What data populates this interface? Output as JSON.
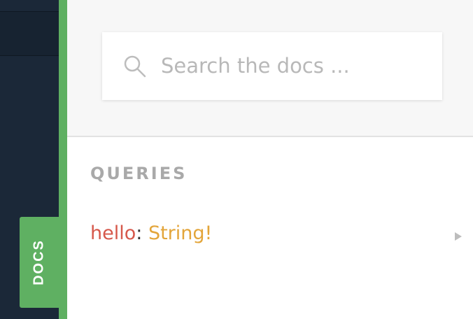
{
  "docs_tab": {
    "label": "DOCS"
  },
  "search": {
    "placeholder": "Search the docs ...",
    "value": ""
  },
  "queries": {
    "section_title": "QUERIES",
    "fields": [
      {
        "name": "hello",
        "separator": ": ",
        "type": "String!"
      }
    ]
  },
  "colors": {
    "accent_green": "#5fb062",
    "editor_dark": "#1b2838",
    "field_name": "#d6584b",
    "field_type": "#e3a53a"
  },
  "icons": {
    "search": "search-icon",
    "chevron": "chevron-right-icon"
  }
}
